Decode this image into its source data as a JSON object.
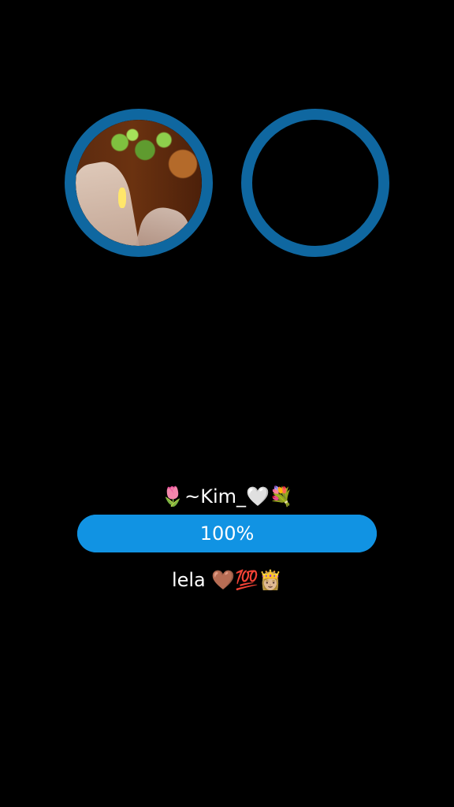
{
  "profiles": {
    "left_avatar": {
      "has_photo": true
    },
    "right_avatar": {
      "has_photo": false
    },
    "ring_color": "#0f67a0"
  },
  "match": {
    "name_top": "🌷~Kim_🤍💐",
    "progress_value": 100,
    "progress_label": "100%",
    "progress_color": "#1193e3",
    "name_bottom": "lela 🤎💯👸🏼"
  }
}
